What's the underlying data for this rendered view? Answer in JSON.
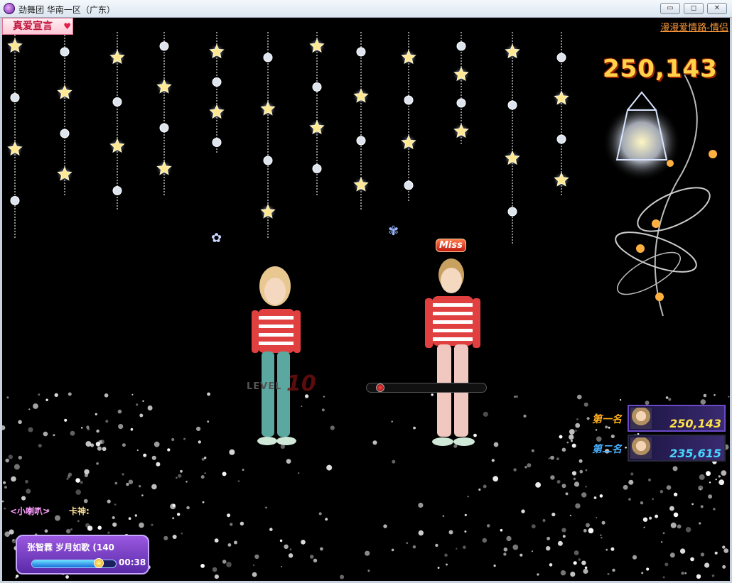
{
  "window": {
    "title": "劲舞团 华南一区（广东）",
    "minimize": "▭",
    "maximize": "◻",
    "close": "✕"
  },
  "banner": {
    "label": "真爱宣言"
  },
  "top_link": "漫漫爱情路-情侣",
  "score": "250,143",
  "hud": {
    "level_text": "LEVEL",
    "level_num": "10",
    "miss": "Miss"
  },
  "ranking": [
    {
      "label": "第一名",
      "score": "250,143",
      "label_color": "#ffb020",
      "score_color": "#ffe24a"
    },
    {
      "label": "第二名",
      "score": "235,615",
      "label_color": "#4ab0ff",
      "score_color": "#4ad4ff"
    }
  ],
  "chat": {
    "tag": "<小喇叭>",
    "label": "卡神:"
  },
  "song": {
    "title": "张智霖 岁月如歌 (140",
    "time": "00:38",
    "progress": 0.8
  },
  "colors": {
    "accent_purple": "#6a4ac8",
    "score_gold": "#ffd24a",
    "link_orange": "#ff9a3a"
  }
}
